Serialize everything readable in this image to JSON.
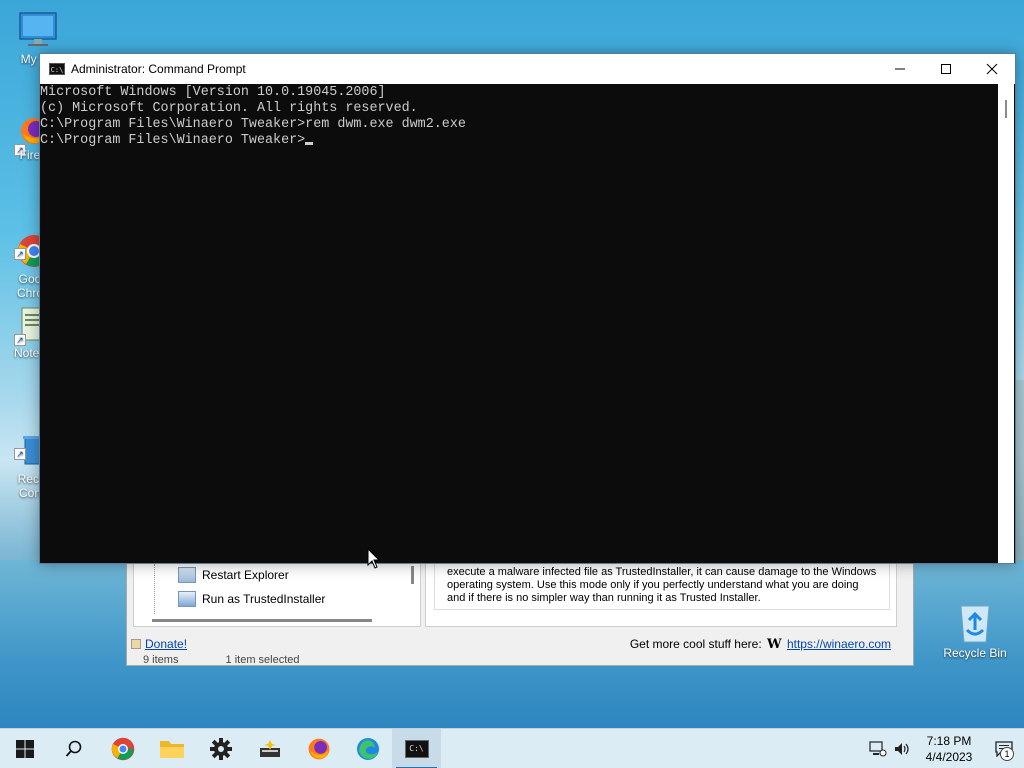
{
  "desktop": {
    "icons": [
      {
        "label": "My Co",
        "icon": "monitor-icon"
      },
      {
        "label": "Fire",
        "icon": "firefox-icon"
      },
      {
        "label": "Goo\nChro",
        "icon": "chrome-icon"
      },
      {
        "label": "Notep",
        "icon": "notepad-icon"
      },
      {
        "label": "Rect\nCon",
        "icon": "recycle-bin-control-icon"
      }
    ],
    "recycle_bin_label": "Recycle Bin"
  },
  "cmd": {
    "title": "Administrator: Command Prompt",
    "icon_text": "C:\\",
    "lines": [
      "Microsoft Windows [Version 10.0.19045.2006]",
      "(c) Microsoft Corporation. All rights reserved.",
      "",
      "C:\\Program Files\\Winaero Tweaker>rem dwm.exe dwm2.exe",
      "",
      "C:\\Program Files\\Winaero Tweaker>"
    ],
    "buttons": {
      "minimize": "—",
      "maximize": "☐",
      "close": "✕"
    }
  },
  "winaero": {
    "tree_items": [
      {
        "label": "Restart Explorer"
      },
      {
        "label": "Run as TrustedInstaller"
      }
    ],
    "description": "execute a malware infected file as TrustedInstaller, it can cause damage to the Windows operating system. Use this mode only if you perfectly understand what you are doing and if there is no simpler way than running it as Trusted Installer.",
    "donate": "Donate!",
    "more_stuff": "Get more cool stuff here:",
    "logo_letter": "W",
    "url": "https://winaero.com",
    "explorer_status": {
      "items": "9 items",
      "selected": "1 item selected"
    }
  },
  "taskbar": {
    "apps": [
      {
        "name": "start",
        "icon": "windows-logo-icon"
      },
      {
        "name": "search",
        "icon": "search-icon"
      },
      {
        "name": "chrome",
        "icon": "chrome-icon"
      },
      {
        "name": "file-explorer",
        "icon": "folder-icon"
      },
      {
        "name": "settings",
        "icon": "gear-icon"
      },
      {
        "name": "winaero",
        "icon": "tweaker-icon"
      },
      {
        "name": "firefox",
        "icon": "firefox-icon"
      },
      {
        "name": "edge",
        "icon": "edge-icon"
      },
      {
        "name": "cmd",
        "icon": "cmd-icon",
        "active": true
      }
    ],
    "time": "7:18 PM",
    "date": "4/4/2023",
    "notification_count": "1"
  }
}
